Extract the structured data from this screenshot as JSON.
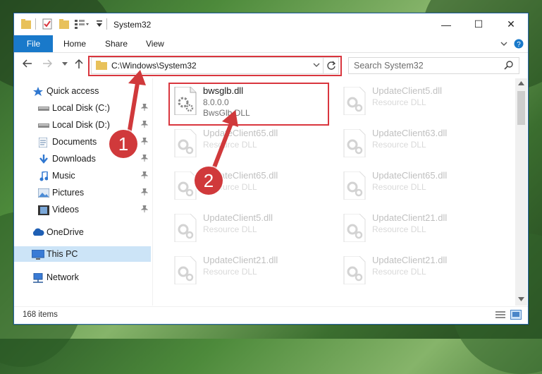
{
  "window": {
    "title": "System32",
    "minimize": "—",
    "maximize": "☐",
    "close": "✕"
  },
  "ribbon": {
    "file_label": "File",
    "home_label": "Home",
    "share_label": "Share",
    "view_label": "View"
  },
  "address": {
    "path": "C:\\Windows\\System32"
  },
  "search": {
    "placeholder": "Search System32"
  },
  "sidebar": {
    "items": [
      {
        "label": "Quick access",
        "icon": "star-icon"
      },
      {
        "label": "Local Disk (C:)",
        "icon": "drive-icon",
        "pinned": true
      },
      {
        "label": "Local Disk (D:)",
        "icon": "drive-icon",
        "pinned": true
      },
      {
        "label": "Documents",
        "icon": "documents-icon",
        "pinned": true
      },
      {
        "label": "Downloads",
        "icon": "download-icon",
        "pinned": true
      },
      {
        "label": "Music",
        "icon": "music-icon",
        "pinned": true
      },
      {
        "label": "Pictures",
        "icon": "pictures-icon",
        "pinned": true
      },
      {
        "label": "Videos",
        "icon": "videos-icon",
        "pinned": true
      },
      {
        "label": "OneDrive",
        "icon": "cloud-icon"
      },
      {
        "label": "This PC",
        "icon": "computer-icon",
        "selected": true
      },
      {
        "label": "Network",
        "icon": "network-icon"
      }
    ]
  },
  "files": [
    {
      "name": "bwsglb.dll",
      "version": "8.0.0.0",
      "description": "BwsGlb DLL",
      "highlighted": true
    },
    {
      "name": "UpdateClient5.dll",
      "description": "Resource DLL"
    },
    {
      "name": "UpdateClient65.dll",
      "description": "Resource DLL"
    },
    {
      "name": "UpdateClient63.dll",
      "description": "Resource DLL"
    },
    {
      "name": "UpdateClient65.dll",
      "description": "Resource DLL"
    },
    {
      "name": "UpdateClient65.dll",
      "description": "Resource DLL"
    },
    {
      "name": "UpdateClient5.dll",
      "description": "Resource DLL"
    },
    {
      "name": "UpdateClient21.dll",
      "description": "Resource DLL"
    },
    {
      "name": "UpdateClient21.dll",
      "description": "Resource DLL"
    },
    {
      "name": "UpdateClient21.dll",
      "description": "Resource DLL"
    }
  ],
  "status": {
    "item_count": "168 items"
  },
  "callouts": {
    "step1": "1",
    "step2": "2"
  },
  "colors": {
    "accent": "#1979ca",
    "highlight": "#d9363e",
    "callout": "#d0393b",
    "selected": "#cce4f7"
  }
}
